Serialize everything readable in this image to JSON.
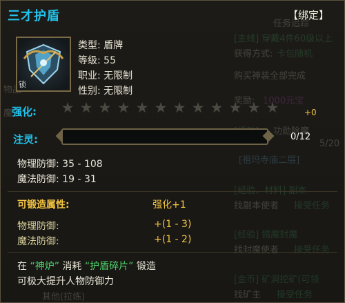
{
  "item": {
    "name": "三才护盾",
    "bind": "【绑定】",
    "info": [
      {
        "label": "类型:",
        "value": "盾牌"
      },
      {
        "label": "等级:",
        "value": "55"
      },
      {
        "label": "职业:",
        "value": "无限制"
      },
      {
        "label": "性别:",
        "value": "无限制"
      }
    ],
    "lock_badge": "锁"
  },
  "enhance": {
    "label": "强化:",
    "stars_total": 12,
    "stars_filled": 0,
    "bonus": "+0"
  },
  "spirit": {
    "label": "注灵:",
    "current": 0,
    "max": 12,
    "text": "0/12"
  },
  "stats": [
    {
      "label": "物理防御:",
      "value": "35 - 108"
    },
    {
      "label": "魔法防御:",
      "value": "19 - 31"
    }
  ],
  "forge": {
    "header": "可锻造属性:",
    "enhance": "强化+1",
    "rows": [
      {
        "label": "物理防御:",
        "value": "+(1 - 3)"
      },
      {
        "label": "魔法防御:",
        "value": "+(1 - 2)"
      }
    ]
  },
  "footer": {
    "p1": "在",
    "q1": "“神炉”",
    "p2": "消耗",
    "q2": "“护盾碎片”",
    "p3": "锻造",
    "line2": "可极大提升人物防御力"
  },
  "background": {
    "texts": [
      "任务追踪",
      "[主线] 穿戴4件60级以上",
      "获得方式:",
      "卡包随机",
      "购买神装全部完成",
      "奖励:",
      "1000元宝",
      "[活动]",
      "功勋除魔",
      "[祖玛寺庙二层]",
      "[经验、材料] 副本",
      "找副本使者",
      "接受任务",
      "[经验] 猎魔封魔",
      "找封魔使者",
      "接受任务",
      "[金币] 矿洞挖矿(可领",
      "找矿主",
      "接受任务",
      "物品",
      "魔",
      "5/20",
      "其他(拉练)"
    ]
  },
  "colors": {
    "title": "#22c3ec",
    "gold": "#f4c441",
    "green": "#4fd26a",
    "text": "#e8e4d6"
  }
}
